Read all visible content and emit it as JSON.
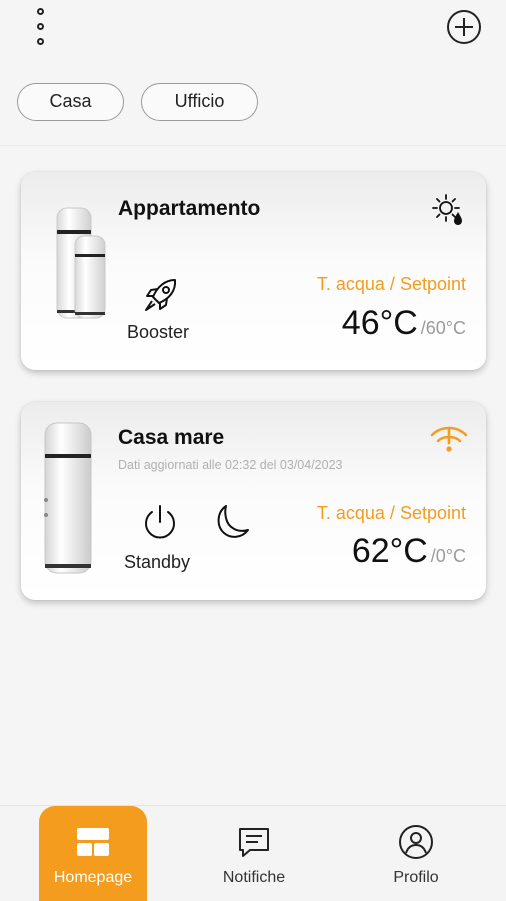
{
  "header": {
    "menu_icon": "vertical-dots-icon",
    "add_icon": "plus-circle-icon"
  },
  "chips": [
    {
      "label": "Casa"
    },
    {
      "label": "Ufficio"
    }
  ],
  "devices": [
    {
      "name": "Appartamento",
      "subtitle": "",
      "status_icon": "sun-water-icon",
      "mode_icon": "rocket-icon",
      "mode_label": "Booster",
      "temp_label": "T. acqua / Setpoint",
      "temp": "46°C",
      "setpoint": "/60°C"
    },
    {
      "name": "Casa mare",
      "subtitle": "Dati aggiornati alle 02:32 del 03/04/2023",
      "status_icon": "wifi-off-icon",
      "mode_icon": "power-icon",
      "extra_icon": "moon-icon",
      "mode_label": "Standby",
      "temp_label": "T. acqua / Setpoint",
      "temp": "62°C",
      "setpoint": "/0°C"
    }
  ],
  "nav": [
    {
      "label": "Homepage",
      "icon": "dashboard-icon",
      "active": true
    },
    {
      "label": "Notifiche",
      "icon": "chat-bubble-icon",
      "active": false
    },
    {
      "label": "Profilo",
      "icon": "user-circle-icon",
      "active": false
    }
  ],
  "colors": {
    "accent": "#f39c1e",
    "background": "#f5f5f5"
  }
}
